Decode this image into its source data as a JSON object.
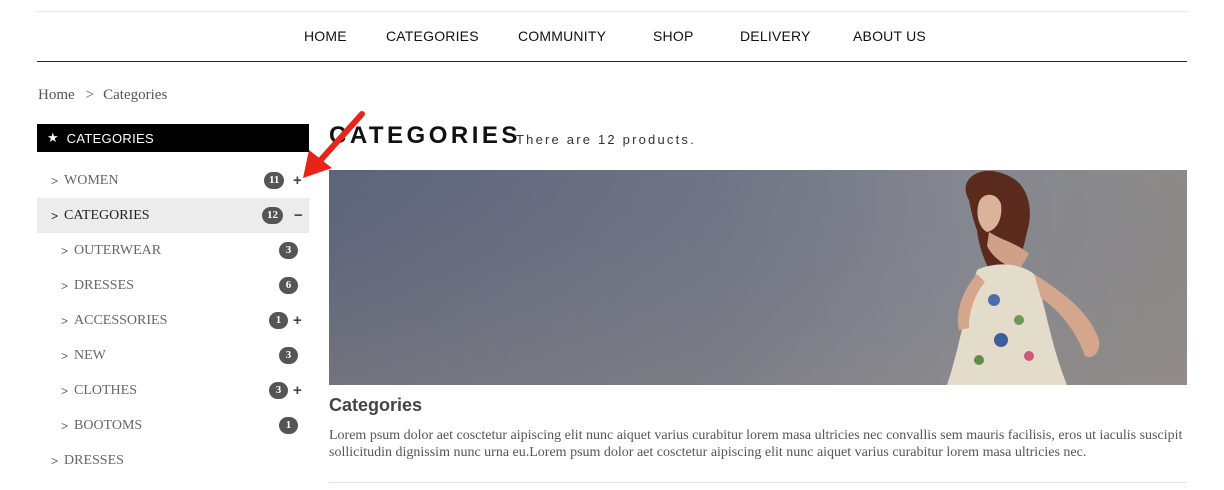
{
  "nav": {
    "items": [
      {
        "label": "HOME"
      },
      {
        "label": "CATEGORIES"
      },
      {
        "label": "COMMUNITY"
      },
      {
        "label": "SHOP"
      },
      {
        "label": "DELIVERY"
      },
      {
        "label": "ABOUT US"
      }
    ]
  },
  "breadcrumb": {
    "home": "Home",
    "separator": ">",
    "current": "Categories"
  },
  "sidebar": {
    "title": "CATEGORIES",
    "star": "★",
    "items": [
      {
        "label": "WOMEN",
        "count": "11",
        "toggle": "+"
      },
      {
        "label": "CATEGORIES",
        "count": "12",
        "toggle": "−"
      },
      {
        "label": "OUTERWEAR",
        "count": "3",
        "toggle": ""
      },
      {
        "label": "DRESSES",
        "count": "6",
        "toggle": ""
      },
      {
        "label": "ACCESSORIES",
        "count": "1",
        "toggle": "+"
      },
      {
        "label": "NEW",
        "count": "3",
        "toggle": ""
      },
      {
        "label": "CLOTHES",
        "count": "3",
        "toggle": "+"
      },
      {
        "label": "BOOTOMS",
        "count": "1",
        "toggle": ""
      },
      {
        "label": "DRESSES",
        "count": "",
        "toggle": ""
      }
    ]
  },
  "main": {
    "title": "CATEGORIES",
    "subtitle": "There are 12 products.",
    "category_name": "Categories",
    "description": "Lorem psum dolor aet cosctetur aipiscing elit nunc aiquet varius curabitur lorem masa ultricies nec convallis sem mauris facilisis, eros ut iaculis suscipit sollicitudin dignissim nunc urna eu.Lorem psum dolor aet cosctetur aipiscing elit nunc aiquet varius curabitur lorem masa ultricies nec."
  },
  "colors": {
    "accent": "#000000",
    "arrow": "#e8231a",
    "badge": "#555555"
  }
}
